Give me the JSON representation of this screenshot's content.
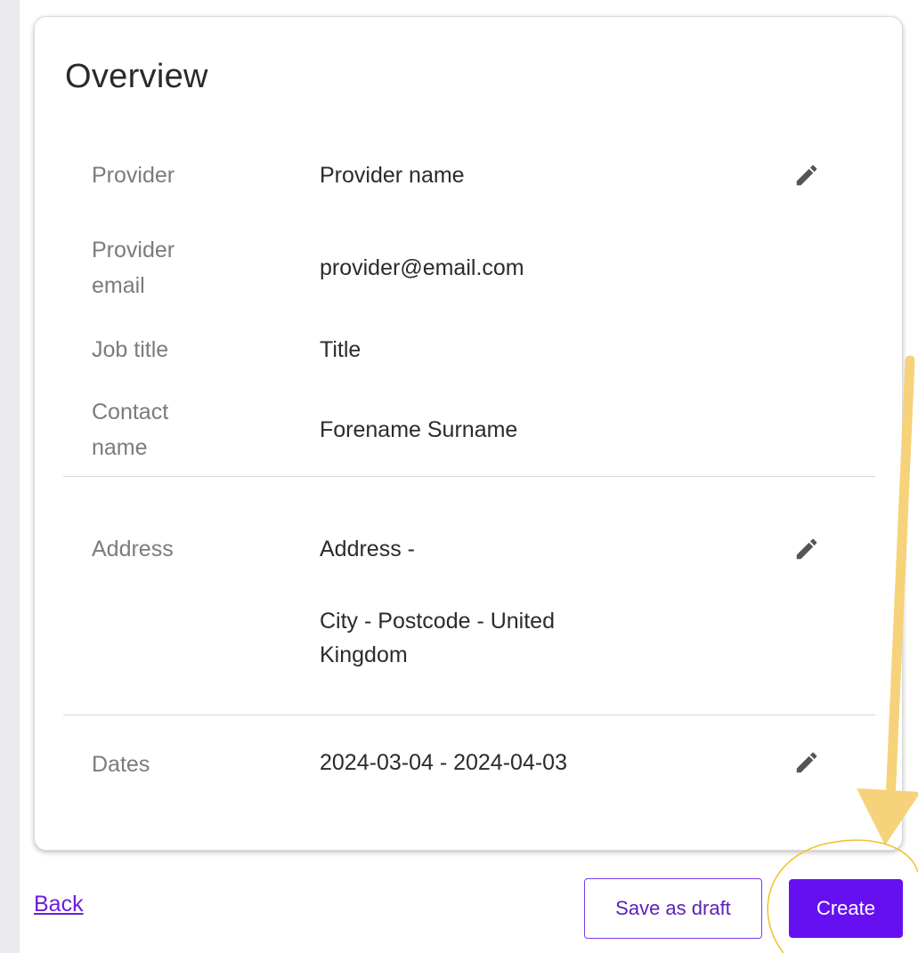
{
  "overview": {
    "title": "Overview",
    "rows": [
      {
        "label": "Provider",
        "value": "Provider name"
      },
      {
        "label": "Provider email",
        "value": "provider@email.com"
      },
      {
        "label": "Job title",
        "value": "Title"
      },
      {
        "label": "Contact name",
        "value": "Forename Surname"
      }
    ],
    "address": {
      "label": "Address",
      "line1": "Address -",
      "line2": "City - Postcode - United Kingdom"
    },
    "dates": {
      "label": "Dates",
      "value": "2024-03-04 - 2024-04-03"
    }
  },
  "footer": {
    "back_label": "Back",
    "save_draft_label": "Save as draft",
    "create_label": "Create"
  },
  "colors": {
    "accent": "#6610f2",
    "annotation_arrow": "#f6d27a",
    "annotation_circle": "#f2c230"
  },
  "icons": {
    "edit": "pencil-icon"
  }
}
